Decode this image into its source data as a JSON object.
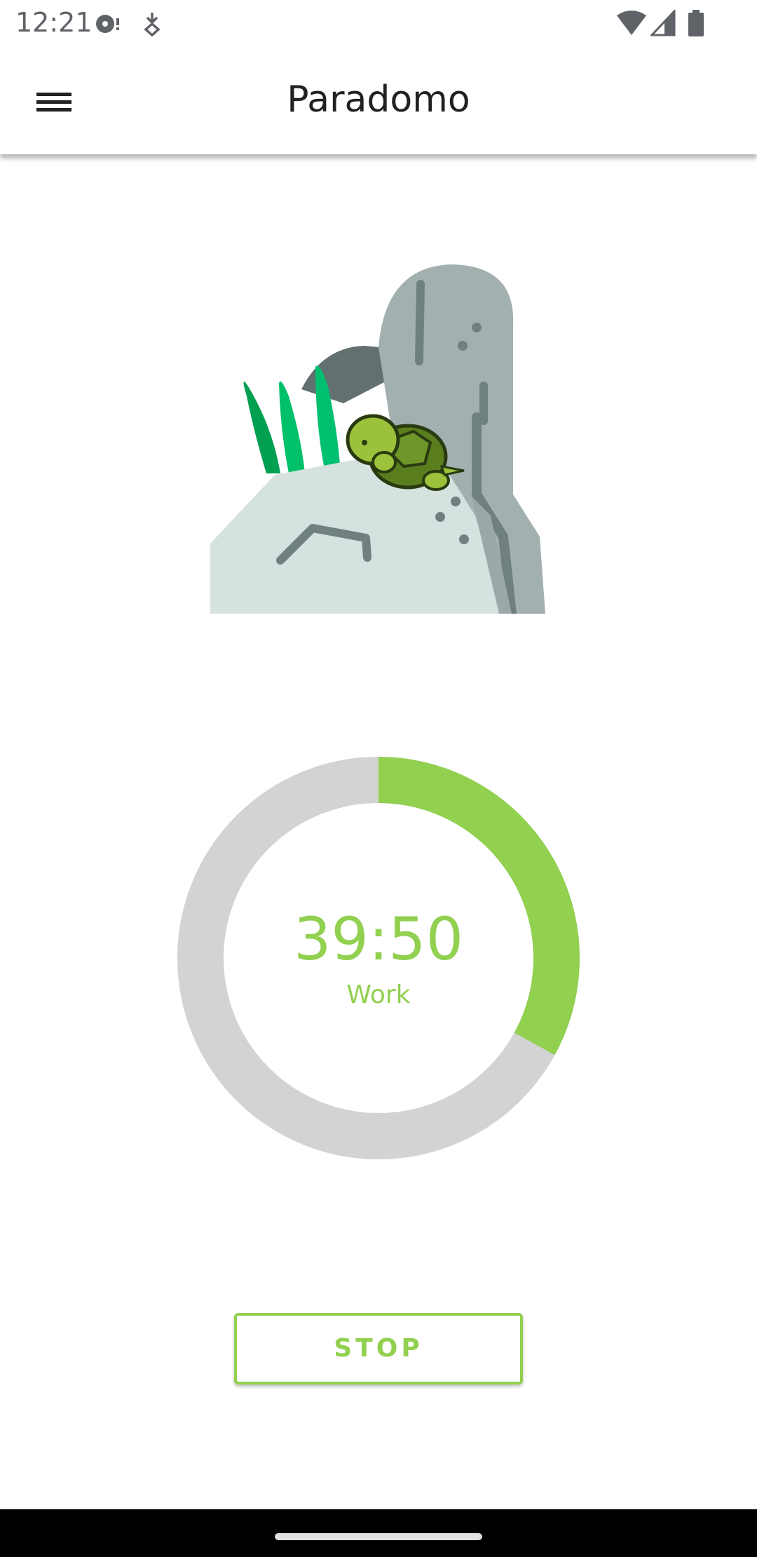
{
  "status_bar": {
    "time": "12:21",
    "icons": [
      "media-icon",
      "download-icon",
      "wifi-icon",
      "signal-icon",
      "battery-icon"
    ]
  },
  "app_bar": {
    "title": "Paradomo",
    "menu_icon": "hamburger-menu-icon"
  },
  "illustration": {
    "subject": "turtle-on-rock"
  },
  "timer": {
    "time": "39:50",
    "mode": "Work",
    "progress_fraction": 0.33,
    "colors": {
      "progress": "#92d050",
      "track": "#d3d3d3"
    }
  },
  "controls": {
    "stop_label": "STOP"
  },
  "colors": {
    "accent": "#92d050",
    "title_text": "#212121"
  }
}
